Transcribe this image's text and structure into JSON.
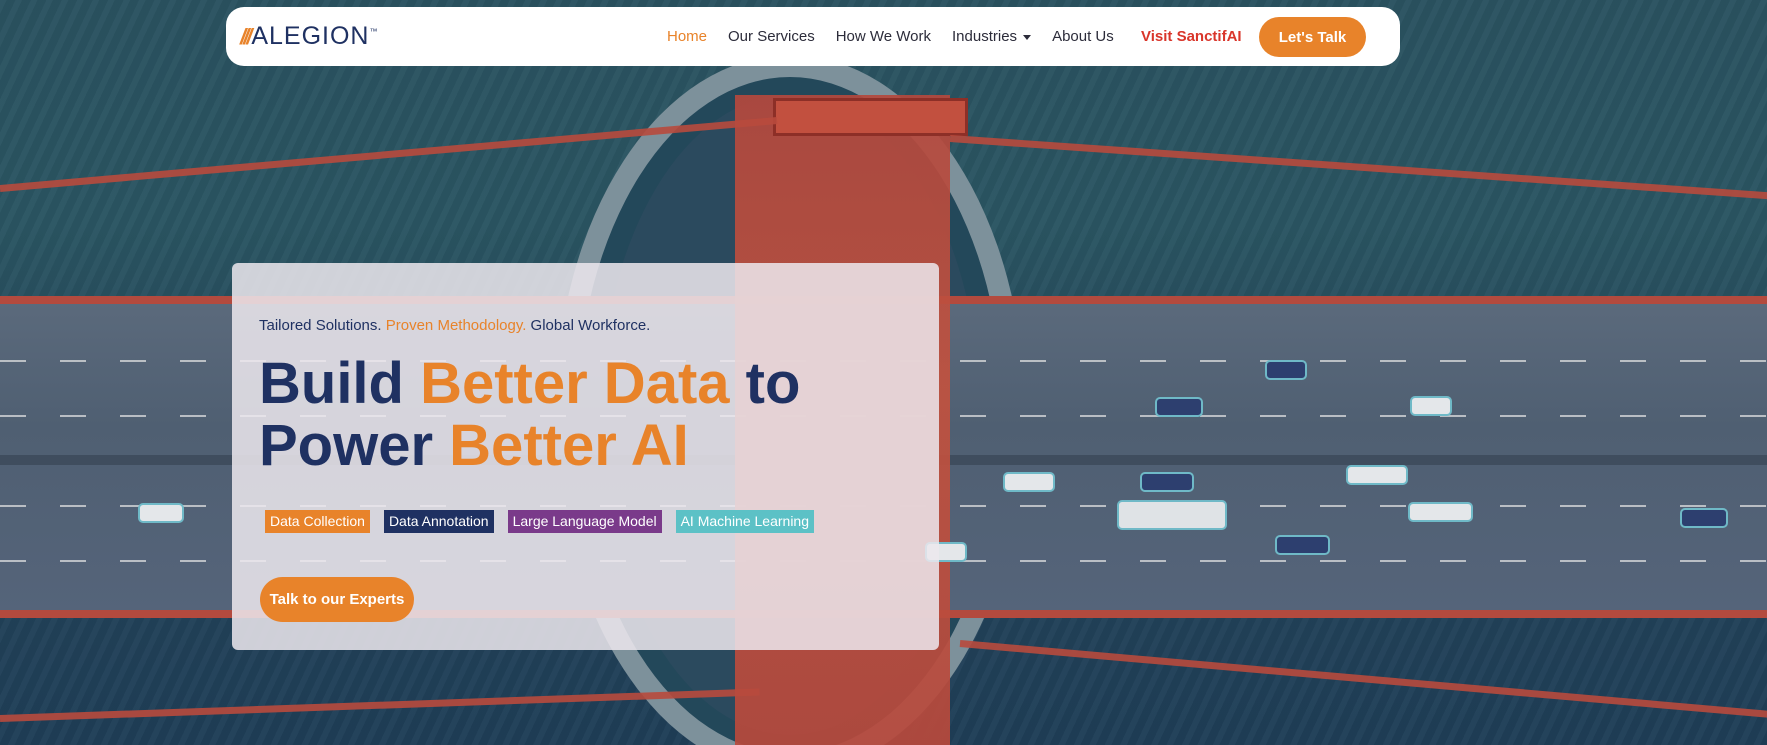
{
  "brand": {
    "logo_slashes": "///",
    "logo_text": "ALEGION",
    "logo_tm": "™",
    "accent_color": "#e8832a",
    "navy_color": "#1f3162",
    "red_color": "#d9352a"
  },
  "nav": {
    "items": [
      {
        "label": "Home",
        "active": true
      },
      {
        "label": "Our Services",
        "active": false
      },
      {
        "label": "How We Work",
        "active": false
      },
      {
        "label": "Industries",
        "active": false,
        "has_dropdown": true
      },
      {
        "label": "About Us",
        "active": false
      }
    ],
    "visit_label": "Visit SanctifAI",
    "cta_label": "Let's Talk"
  },
  "hero": {
    "tagline_1": "Tailored Solutions. ",
    "tagline_2": "Proven Methodology.",
    "tagline_3": " Global Workforce.",
    "headline_1": "Build ",
    "headline_2": "Better Data",
    "headline_3": " to Power ",
    "headline_4": "Better AI",
    "chips": [
      {
        "label": "Data Collection",
        "color": "#e8832a"
      },
      {
        "label": "Data Annotation",
        "color": "#1f3162"
      },
      {
        "label": "Large Language Model",
        "color": "#7a3a8a"
      },
      {
        "label": "AI Machine Learning",
        "color": "#5cc1c6"
      }
    ],
    "button_label": "Talk to our Experts"
  }
}
